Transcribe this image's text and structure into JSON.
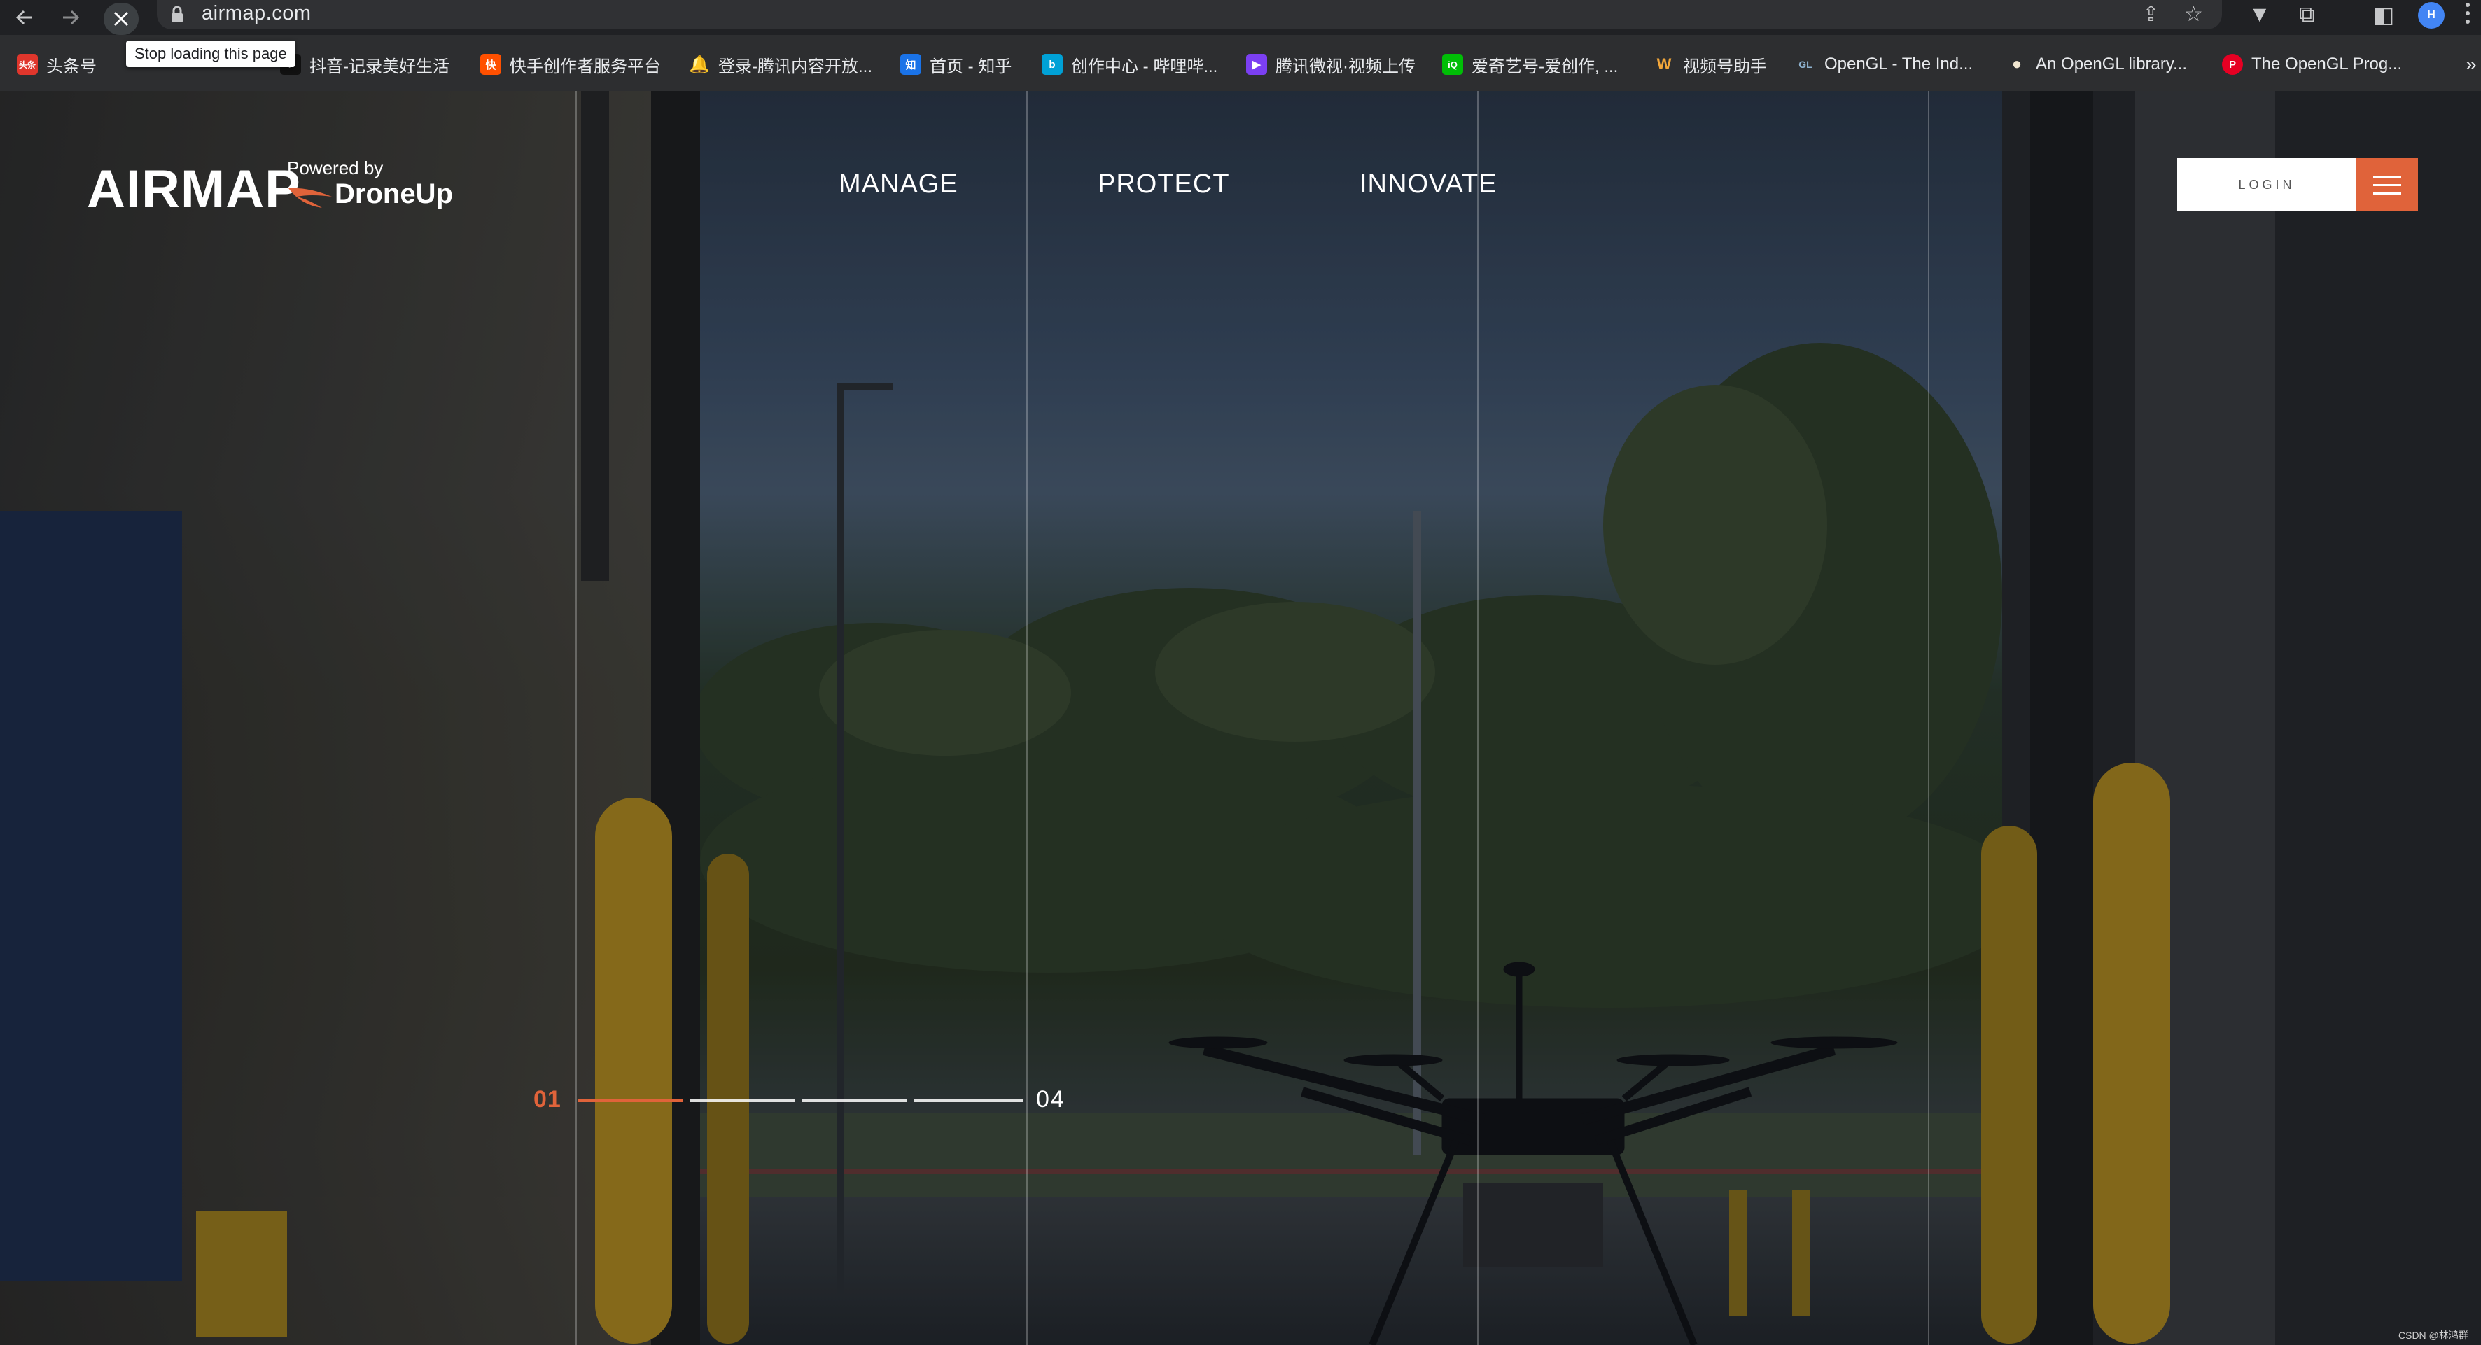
{
  "browser": {
    "url": "airmap.com",
    "stop_tooltip": "Stop loading this page",
    "profile_initial": "H",
    "icons": {
      "back": "arrow-left-icon",
      "forward": "arrow-right-icon",
      "stop": "close-icon",
      "share": "share-icon",
      "bookmark": "star-icon",
      "extensions": "puzzle-icon",
      "side_panel": "side-panel-icon",
      "menu": "kebab-menu-icon"
    }
  },
  "bookmarks": [
    {
      "label": "头条号",
      "icon_text": "头条",
      "color": "#e0362c"
    },
    {
      "label": "抖音-记录美好生活",
      "icon_text": "♪",
      "color": "#111111"
    },
    {
      "label": "快手创作者服务平台",
      "icon_text": "快",
      "color": "#ff5000"
    },
    {
      "label": "登录-腾讯内容开放...",
      "icon_text": "🔔",
      "color": "#f5b82e"
    },
    {
      "label": "首页 - 知乎",
      "icon_text": "知",
      "color": "#1a73e8"
    },
    {
      "label": "创作中心 - 哔哩哔...",
      "icon_text": "b",
      "color": "#00a1d6"
    },
    {
      "label": "腾讯微视·视频上传",
      "icon_text": "▶",
      "color": "#7b3ff2"
    },
    {
      "label": "爱奇艺号-爱创作, ...",
      "icon_text": "iQ",
      "color": "#00be06"
    },
    {
      "label": "视频号助手",
      "icon_text": "W",
      "color": "#f2a63a"
    },
    {
      "label": "OpenGL - The Ind...",
      "icon_text": "GL",
      "color": "#5586a4"
    },
    {
      "label": "An OpenGL library...",
      "icon_text": "●",
      "color": "#f0e6d0"
    },
    {
      "label": "The OpenGL Prog...",
      "icon_text": "P",
      "color": "#e60023"
    }
  ],
  "site": {
    "logo": {
      "wordmark": "AIRMAP",
      "powered_by": "Powered by",
      "partner": "DroneUp",
      "accent": "#e0633a"
    },
    "nav": [
      "MANAGE",
      "PROTECT",
      "INNOVATE"
    ],
    "login_label": "LOGIN",
    "menu_icon": "hamburger-menu-icon",
    "slider": {
      "current": "01",
      "total": "04",
      "progress": 0.25
    },
    "watermark": "CSDN @林鸿群"
  },
  "colors": {
    "accent": "#e0633a",
    "chrome_bg": "#202124",
    "bookmarks_bg": "#2d2e30"
  }
}
